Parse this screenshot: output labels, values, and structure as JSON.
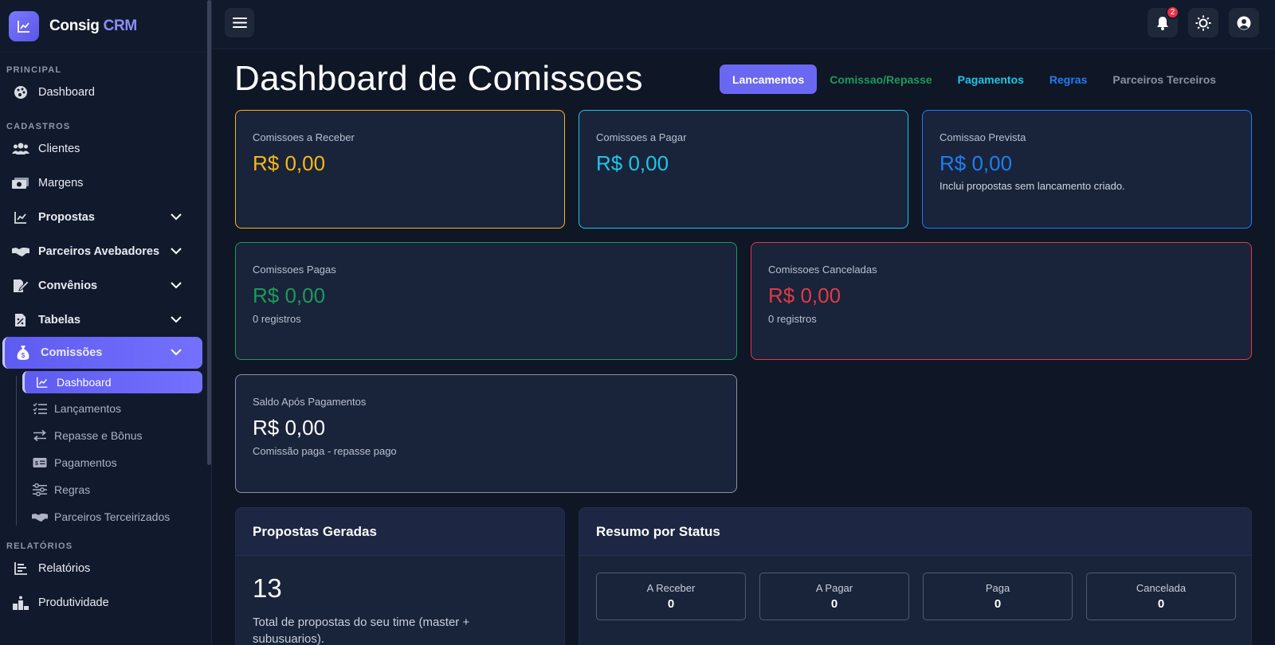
{
  "brand": {
    "name": "Consig",
    "accent": "CRM"
  },
  "sidebar": {
    "sections": {
      "principal": "PRINCIPAL",
      "cadastros": "CADASTROS",
      "relatorios": "RELATÓRIOS"
    },
    "items": {
      "dashboard": "Dashboard",
      "clientes": "Clientes",
      "margens": "Margens",
      "propostas": "Propostas",
      "parceiros": "Parceiros Avebadores",
      "convenios": "Convênios",
      "tabelas": "Tabelas",
      "comissoes": "Comissões",
      "relatorios": "Relatórios",
      "produtividade": "Produtividade"
    },
    "comissoes_sub": {
      "dashboard": "Dashboard",
      "lancamentos": "Lançamentos",
      "repasse": "Repasse e Bônus",
      "pagamentos": "Pagamentos",
      "regras": "Regras",
      "terceirizados": "Parceiros Terceirizados"
    }
  },
  "topbar": {
    "notification_count": "2"
  },
  "page": {
    "title": "Dashboard de Comissoes"
  },
  "tabs": {
    "lancamentos": "Lancamentos",
    "comissao": "Comissao/Repasse",
    "pagamentos": "Pagamentos",
    "regras": "Regras",
    "parceiros": "Parceiros Terceiros"
  },
  "cards": {
    "receber": {
      "label": "Comissoes a Receber",
      "value": "R$ 0,00"
    },
    "pagar": {
      "label": "Comissoes a Pagar",
      "value": "R$ 0,00"
    },
    "prevista": {
      "label": "Comissao Prevista",
      "value": "R$ 0,00",
      "sub": "Inclui propostas sem lancamento criado."
    },
    "pagas": {
      "label": "Comissoes Pagas",
      "value": "R$ 0,00",
      "sub": "0 registros"
    },
    "canceladas": {
      "label": "Comissoes Canceladas",
      "value": "R$ 0,00",
      "sub": "0 registros"
    },
    "saldo": {
      "label": "Saldo Após Pagamentos",
      "value": "R$ 0,00",
      "sub": "Comissão paga - repasse pago"
    }
  },
  "propostas_panel": {
    "title": "Propostas Geradas",
    "count": "13",
    "desc_line1": "Total de propostas do seu time (master +",
    "desc_line2": "subusuarios)."
  },
  "status_panel": {
    "title": "Resumo por Status",
    "boxes": [
      {
        "label": "A Receber",
        "value": "0"
      },
      {
        "label": "A Pagar",
        "value": "0"
      },
      {
        "label": "Paga",
        "value": "0"
      },
      {
        "label": "Cancelada",
        "value": "0"
      }
    ]
  },
  "colors": {
    "accent": "#6a67f2",
    "receber": "#f5b814",
    "pagar": "#1ec5e6",
    "prevista": "#1f7ef2",
    "pagas": "#1d9a5a",
    "canceladas": "#e03a45",
    "saldo": "#8a91a3"
  }
}
